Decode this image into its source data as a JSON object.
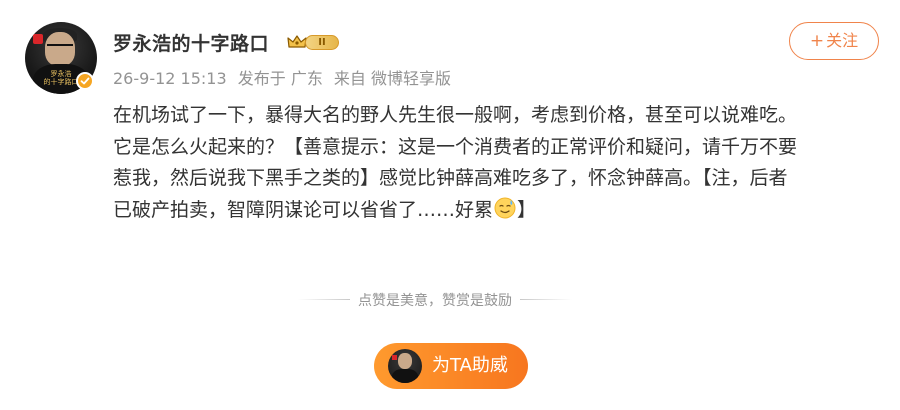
{
  "author": {
    "name": "罗永浩的十字路口",
    "level_badge": "II",
    "avatar_caption_line1": "罗永浩",
    "avatar_caption_line2": "的十字路口"
  },
  "meta": {
    "time": "26-9-12 15:13",
    "posted_in": "发布于 广东",
    "source": "来自 微博轻享版"
  },
  "follow_button": {
    "icon": "plus-icon",
    "label": "关注"
  },
  "post": {
    "lines": [
      "在机场试了一下，暴得大名的野人先生很一般啊，考虑到价格，甚至可以说难吃。",
      "它是怎么火起来的？【善意提示：这是一个消费者的正常评价和疑问，请千万不要",
      "惹我，然后说我下黑手之类的】感觉比钟薛高难吃多了，怀念钟薛高。【注，后者",
      "已破产拍卖，智障阴谋论可以省省了……好累"
    ],
    "last_line_suffix": "】",
    "emoji": "sweat-smile-emoji"
  },
  "reward": {
    "hint": "点赞是美意，赞赏是鼓励",
    "button_label": "为TA助威"
  },
  "colors": {
    "accent_orange": "#f0844b",
    "button_gradient_start": "#ff9a2e",
    "button_gradient_end": "#f7761f",
    "meta_gray": "#939393",
    "text": "#333333"
  }
}
